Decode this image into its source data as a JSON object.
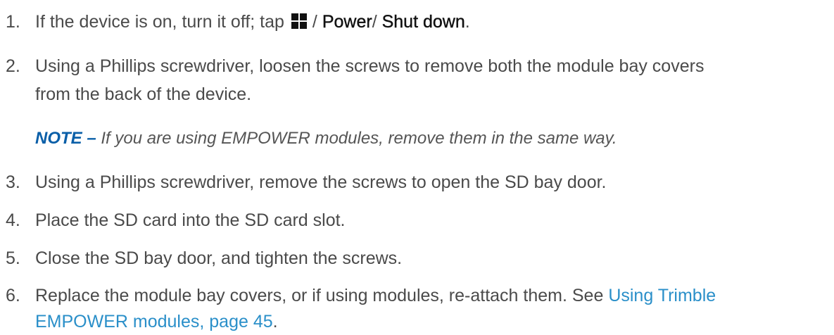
{
  "steps": [
    {
      "number": "1.",
      "text_before": "If the device is on, turn it off; tap",
      "icon": "windows-start-icon",
      "sep1": "/",
      "menu1": "Power",
      "sep2": "/",
      "menu2": "Shut down",
      "end": "."
    },
    {
      "number": "2.",
      "line1": "Using a Phillips screwdriver, loosen the screws to remove both the module bay covers",
      "line2": "from the back of the device."
    },
    {
      "note_label": "NOTE –",
      "note_text": "If you are using EMPOWER modules, remove them in the same way."
    },
    {
      "number": "3.",
      "text": "Using a Phillips screwdriver, remove the screws to open the SD bay door."
    },
    {
      "number": "4.",
      "text": "Place the SD card into the SD card slot."
    },
    {
      "number": "5.",
      "text": "Close the SD bay door, and tighten the screws."
    },
    {
      "number": "6.",
      "line1_text": "Replace the module bay covers, or if using modules, re-attach them. See",
      "link_part1": "Using Trimble",
      "link_part2": "EMPOWER modules, page 45",
      "end": "."
    }
  ],
  "colors": {
    "body_text": "#4a4a4a",
    "bold_text": "#111111",
    "note_label": "#0a5fa8",
    "link": "#2a8fc9"
  }
}
